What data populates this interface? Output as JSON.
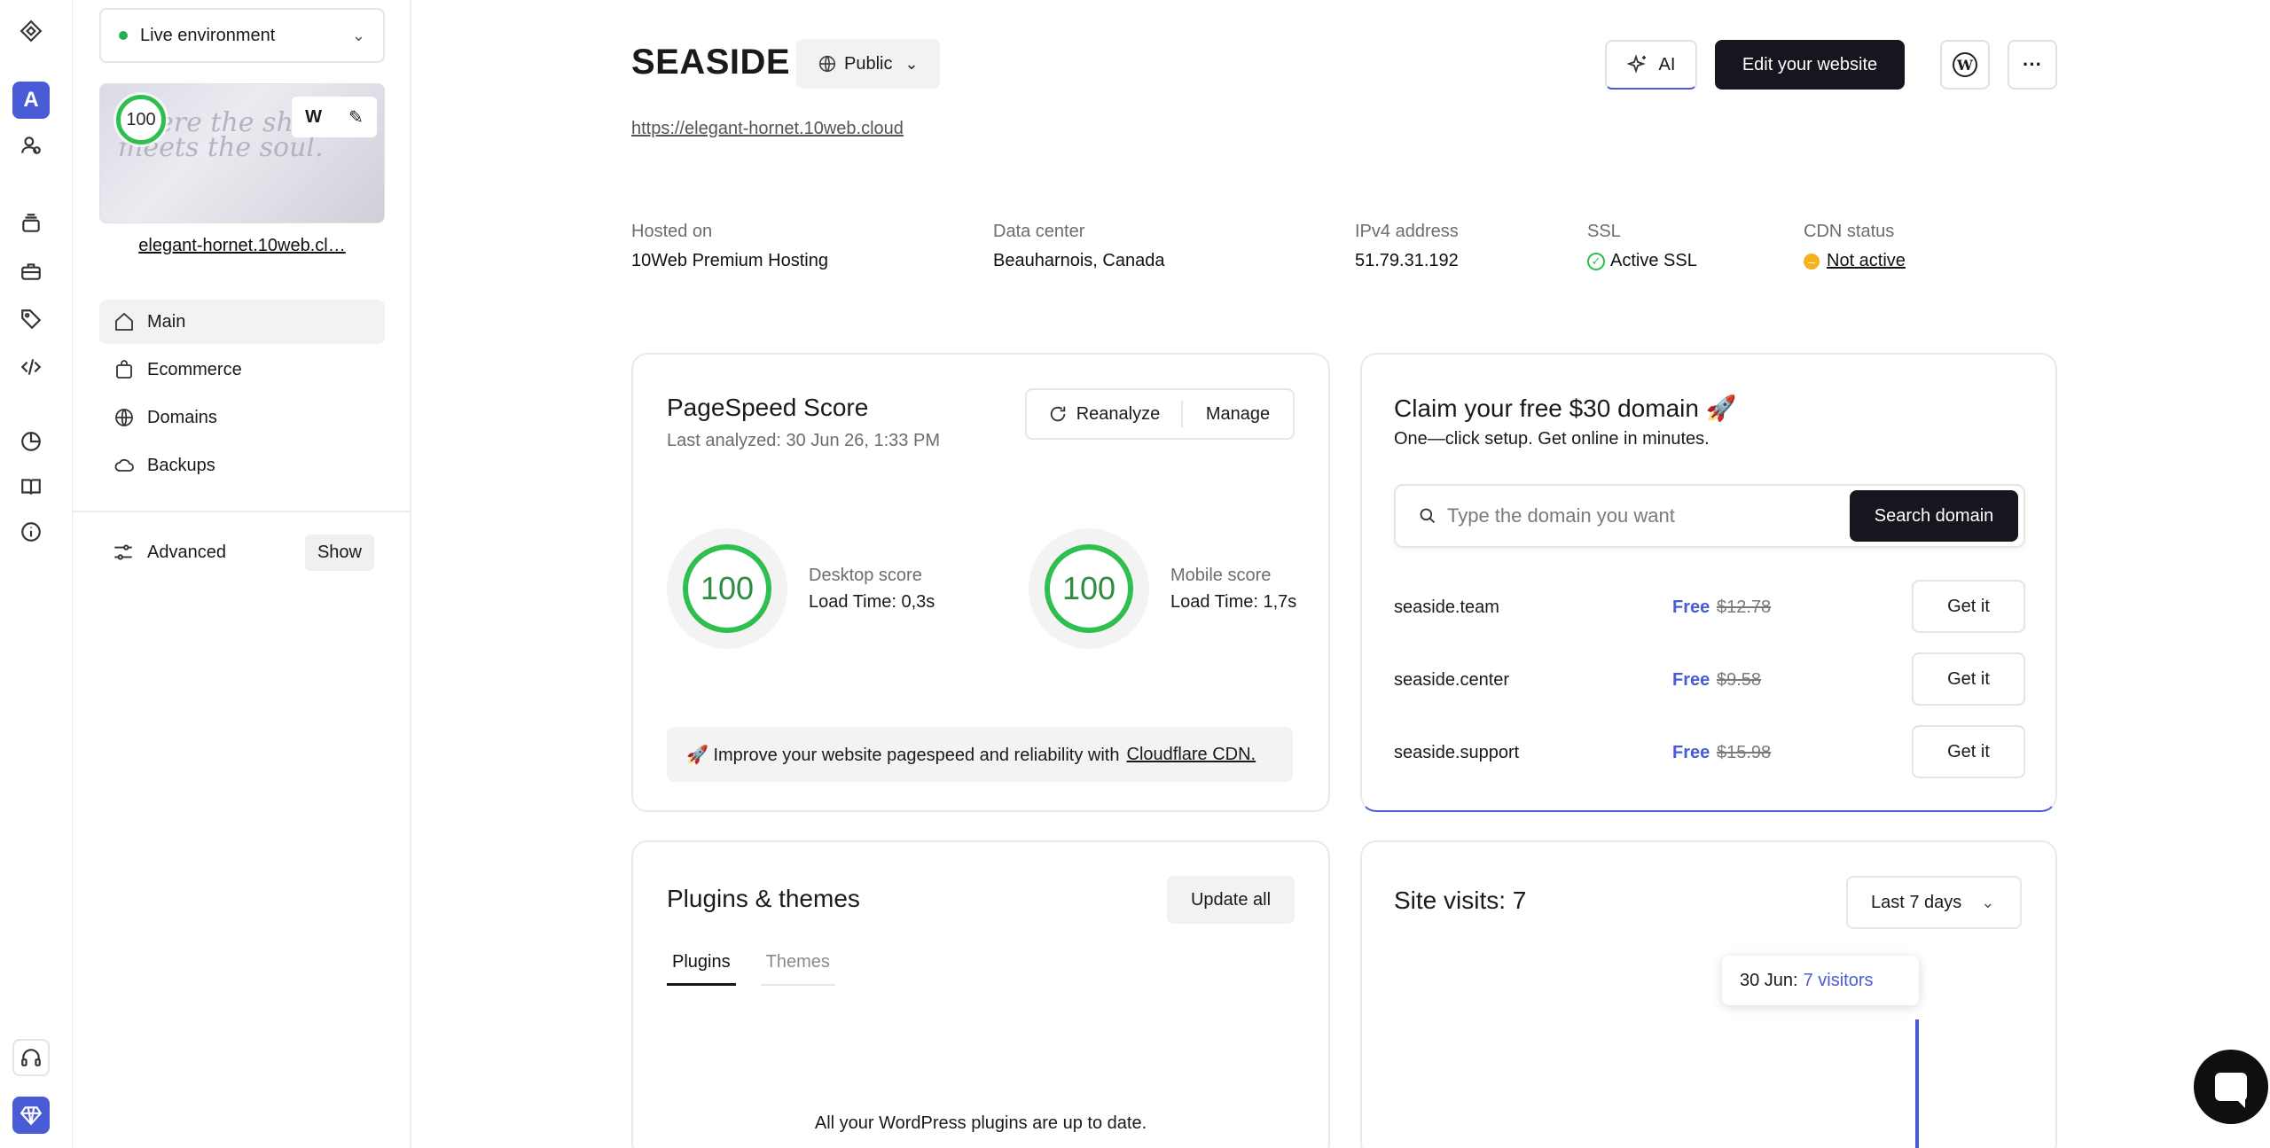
{
  "rail": {
    "logo_icon": "diamond-logo-icon",
    "avatar_letter": "A",
    "icons": [
      "users-icon",
      "layers-icon",
      "briefcase-icon",
      "tag-icon",
      "code-icon",
      "chart-pie-icon",
      "book-icon",
      "info-icon",
      "headset-icon",
      "diamond-icon"
    ]
  },
  "sidebar": {
    "environment": "Live environment",
    "environment_status_color": "#22b14c",
    "preview_text": "where the shore meets the soul.",
    "preview_score": "100",
    "preview_tools": [
      "W",
      "✎"
    ],
    "site_link": "elegant-hornet.10web.cl…",
    "nav": [
      {
        "label": "Main",
        "icon": "home-icon",
        "active": true
      },
      {
        "label": "Ecommerce",
        "icon": "shopping-bag-icon",
        "active": false
      },
      {
        "label": "Domains",
        "icon": "globe-icon",
        "active": false
      },
      {
        "label": "Backups",
        "icon": "cloud-icon",
        "active": false
      }
    ],
    "advanced_label": "Advanced",
    "show_label": "Show"
  },
  "header": {
    "site_title": "SEASIDE",
    "visibility": "Public",
    "url": "https://elegant-hornet.10web.cloud",
    "ai_label": "AI",
    "edit_label": "Edit your website",
    "more_label": "···"
  },
  "info": {
    "hosted_on": {
      "label": "Hosted on",
      "value": "10Web Premium Hosting"
    },
    "data_center": {
      "label": "Data center",
      "value": "Beauharnois, Canada"
    },
    "ipv4": {
      "label": "IPv4 address",
      "value": "51.79.31.192"
    },
    "ssl": {
      "label": "SSL",
      "value": "Active SSL"
    },
    "cdn": {
      "label": "CDN status",
      "value": "Not active"
    }
  },
  "pagespeed": {
    "title": "PageSpeed Score",
    "last_analyzed": "Last analyzed: 30 Jun 26, 1:33 PM",
    "reanalyze_label": "Reanalyze",
    "manage_label": "Manage",
    "desktop": {
      "score": "100",
      "label": "Desktop score",
      "load": "Load Time: 0,3s"
    },
    "mobile": {
      "score": "100",
      "label": "Mobile score",
      "load": "Load Time: 1,7s"
    },
    "tip_text": "🚀 Improve your website pagespeed and reliability with",
    "tip_link": "Cloudflare CDN."
  },
  "domain_offer": {
    "title": "Claim your free $30 domain 🚀",
    "subtitle": "One—click setup. Get online in minutes.",
    "search_placeholder": "Type the domain you want",
    "search_button": "Search domain",
    "rows": [
      {
        "name": "seaside.team",
        "free": "Free",
        "old_price": "$12.78",
        "action": "Get it"
      },
      {
        "name": "seaside.center",
        "free": "Free",
        "old_price": "$9.58",
        "action": "Get it"
      },
      {
        "name": "seaside.support",
        "free": "Free",
        "old_price": "$15.98",
        "action": "Get it"
      }
    ]
  },
  "plugins": {
    "title": "Plugins & themes",
    "update_all": "Update all",
    "tabs": [
      "Plugins",
      "Themes"
    ],
    "status": "All your WordPress plugins are up to date."
  },
  "visits": {
    "title": "Site visits: 7",
    "range": "Last 7 days",
    "tooltip_date": "30 Jun:",
    "tooltip_value": "7 visitors",
    "accent": "#4a5bd6"
  },
  "chart_data": {
    "type": "bar",
    "categories": [
      "30 Jun"
    ],
    "values": [
      7
    ],
    "title": "Site visits: 7"
  }
}
